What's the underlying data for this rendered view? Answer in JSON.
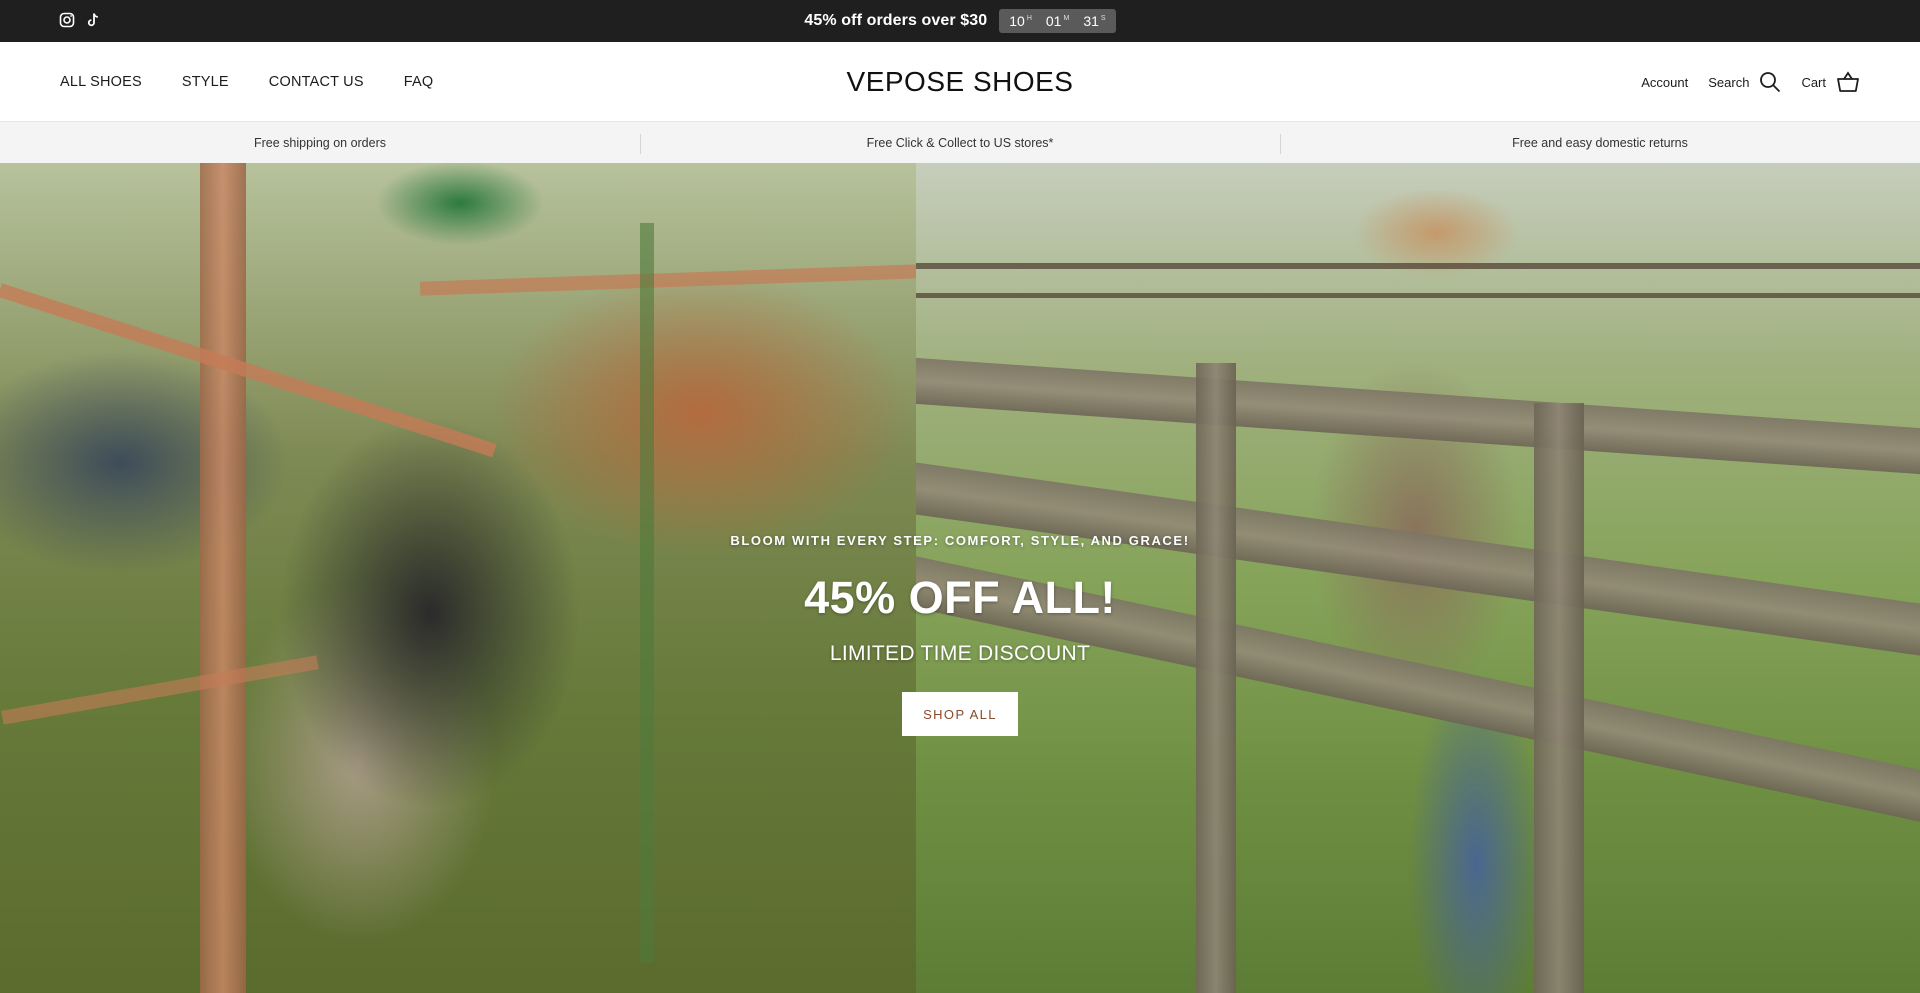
{
  "announcement": {
    "text": "45% off orders over $30",
    "timer": {
      "hours": "10",
      "hours_unit": "H",
      "minutes": "01",
      "minutes_unit": "M",
      "seconds": "31",
      "seconds_unit": "S"
    },
    "social_icons": [
      "instagram-icon",
      "tiktok-icon"
    ]
  },
  "header": {
    "nav": [
      "ALL SHOES",
      "STYLE",
      "CONTACT US",
      "FAQ"
    ],
    "logo": "VEPOSE SHOES",
    "account_label": "Account",
    "search_label": "Search",
    "cart_label": "Cart"
  },
  "usp": [
    "Free shipping on orders",
    "Free Click & Collect to US stores*",
    "Free and easy domestic returns"
  ],
  "hero": {
    "kicker": "BLOOM WITH EVERY STEP: COMFORT, STYLE, AND GRACE!",
    "title": "45% OFF ALL!",
    "subtitle": "LIMITED TIME DISCOUNT",
    "button_label": "SHOP ALL"
  },
  "colors": {
    "announcement_bg": "#1f1f1f",
    "usp_bg": "#f4f4f5",
    "button_text": "#8a4a2c"
  }
}
